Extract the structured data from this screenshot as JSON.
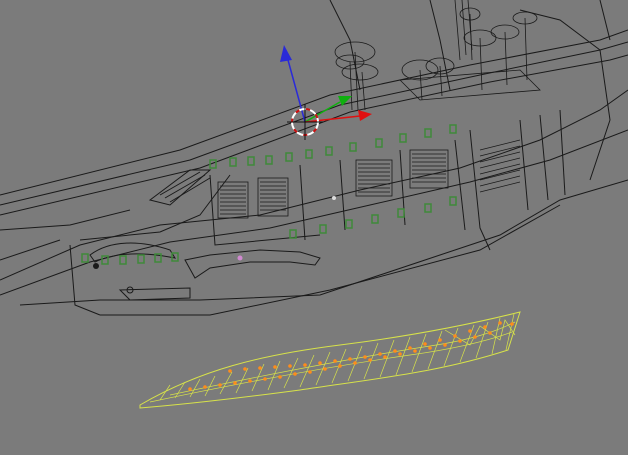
{
  "viewport": {
    "background": "#7b7b7b",
    "wire_color": "#1a1a1a",
    "selected_edge_color": "#d7e24a",
    "selected_vertex_color": "#ff8c1a",
    "bone_green": "#3f8a3a"
  },
  "manipulator": {
    "icons": [
      "z-axis-arrow-icon",
      "y-axis-arrow-icon",
      "x-axis-arrow-icon",
      "3d-cursor-icon"
    ],
    "colors": {
      "x": "#e01010",
      "y": "#10b010",
      "z": "#2a2ad8",
      "cursor": "#ffffff"
    }
  },
  "selection": {
    "object": "selected-mesh-strip",
    "mode": "edit"
  }
}
